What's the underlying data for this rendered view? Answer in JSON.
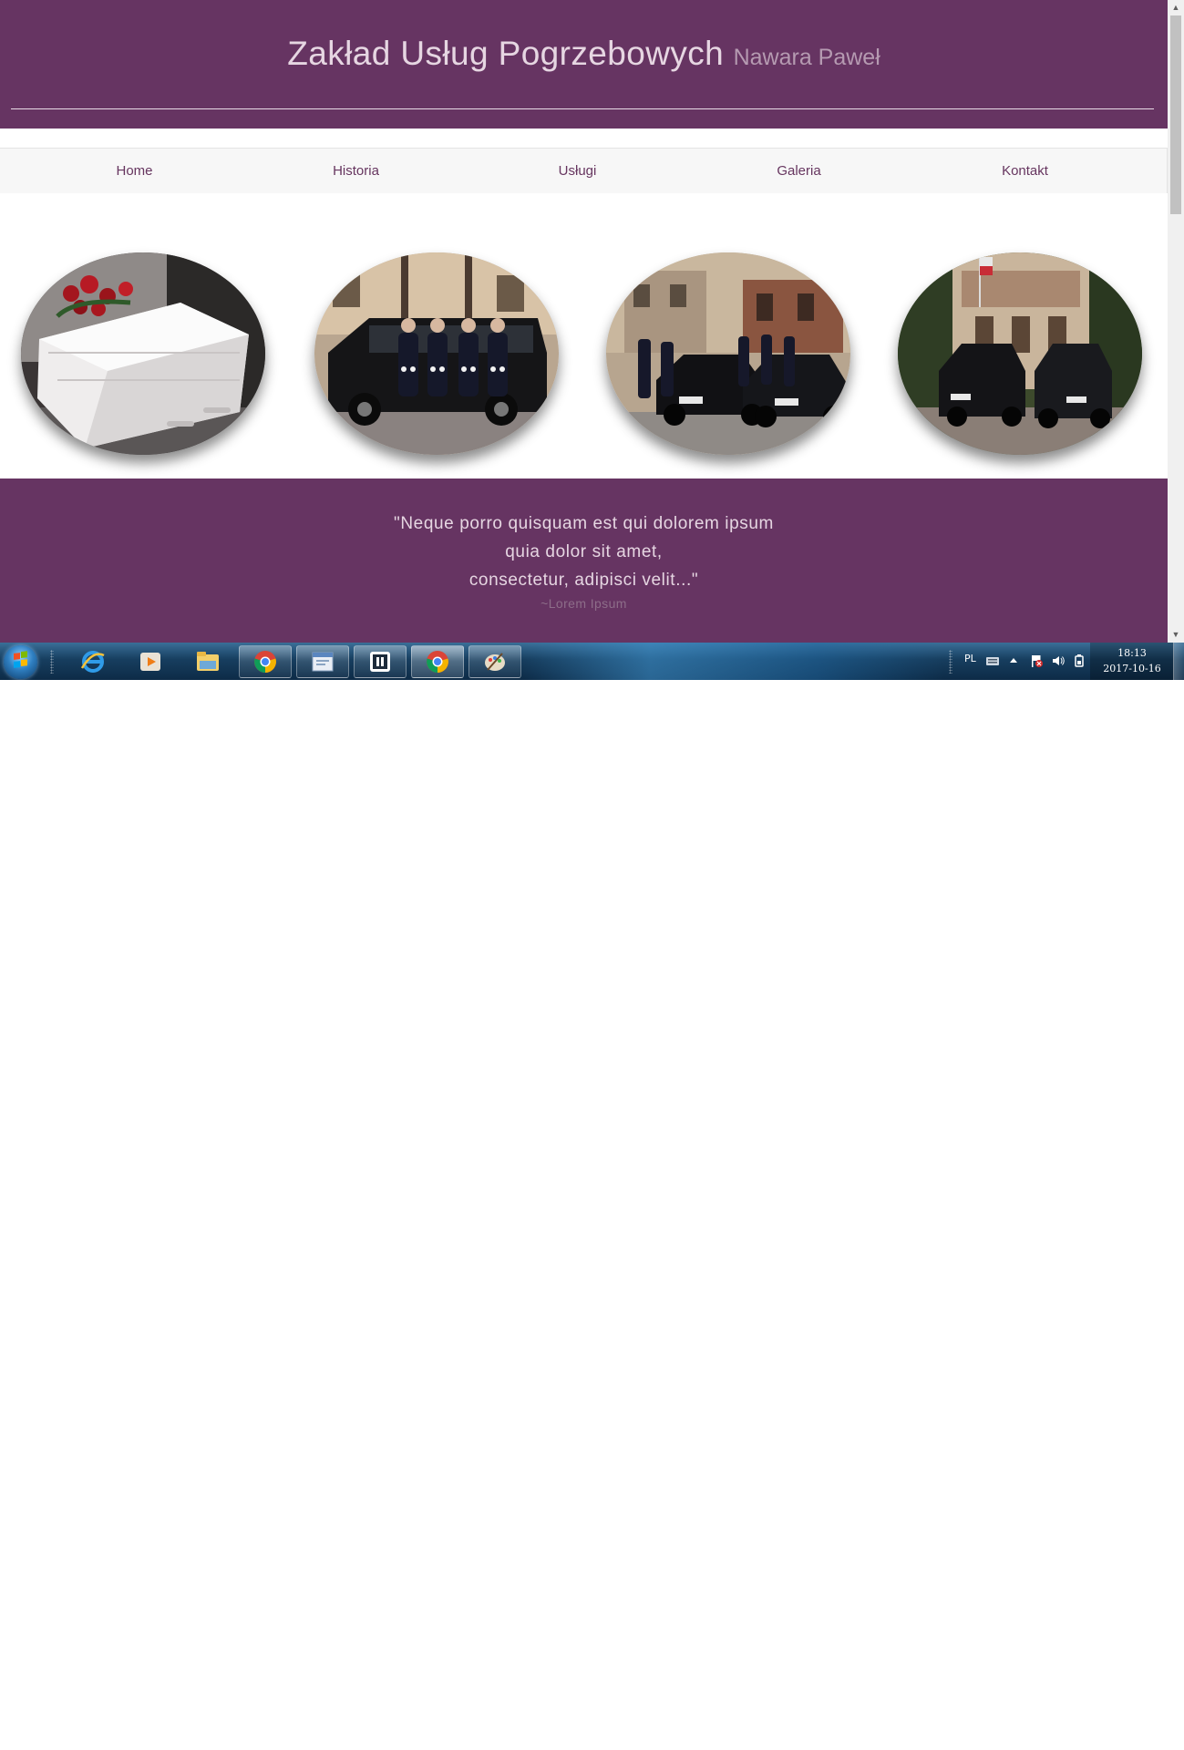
{
  "header": {
    "title": "Zakład Usług Pogrzebowych",
    "subtitle": "Nawara Paweł"
  },
  "nav": {
    "items": [
      {
        "label": "Home"
      },
      {
        "label": "Historia"
      },
      {
        "label": "Usługi"
      },
      {
        "label": "Galeria"
      },
      {
        "label": "Kontakt"
      }
    ]
  },
  "gallery": {
    "photos": [
      {
        "icon": "coffin-photo"
      },
      {
        "icon": "hearse-staff-photo"
      },
      {
        "icon": "funeral-cars-photo"
      },
      {
        "icon": "building-cars-photo"
      }
    ]
  },
  "quote": {
    "lines": [
      "\"Neque porro quisquam est qui dolorem ipsum",
      "quia dolor sit amet,",
      "consectetur, adipisci velit...\""
    ],
    "author": "~Lorem Ipsum"
  },
  "taskbar": {
    "language": "PL",
    "time": "18:13",
    "date": "2017-10-16",
    "apps": [
      {
        "icon": "internet-explorer-icon",
        "state": "pinned"
      },
      {
        "icon": "media-player-icon",
        "state": "pinned"
      },
      {
        "icon": "file-explorer-icon",
        "state": "pinned"
      },
      {
        "icon": "chrome-icon",
        "state": "open"
      },
      {
        "icon": "window-app-icon",
        "state": "open"
      },
      {
        "icon": "dark-app-icon",
        "state": "open"
      },
      {
        "icon": "chrome-icon",
        "state": "active"
      },
      {
        "icon": "paint-icon",
        "state": "open"
      }
    ]
  },
  "colors": {
    "brand": "#663462",
    "header_text": "#e6d6e2",
    "nav_text": "#66355f",
    "nav_bg": "#f7f7f7"
  }
}
